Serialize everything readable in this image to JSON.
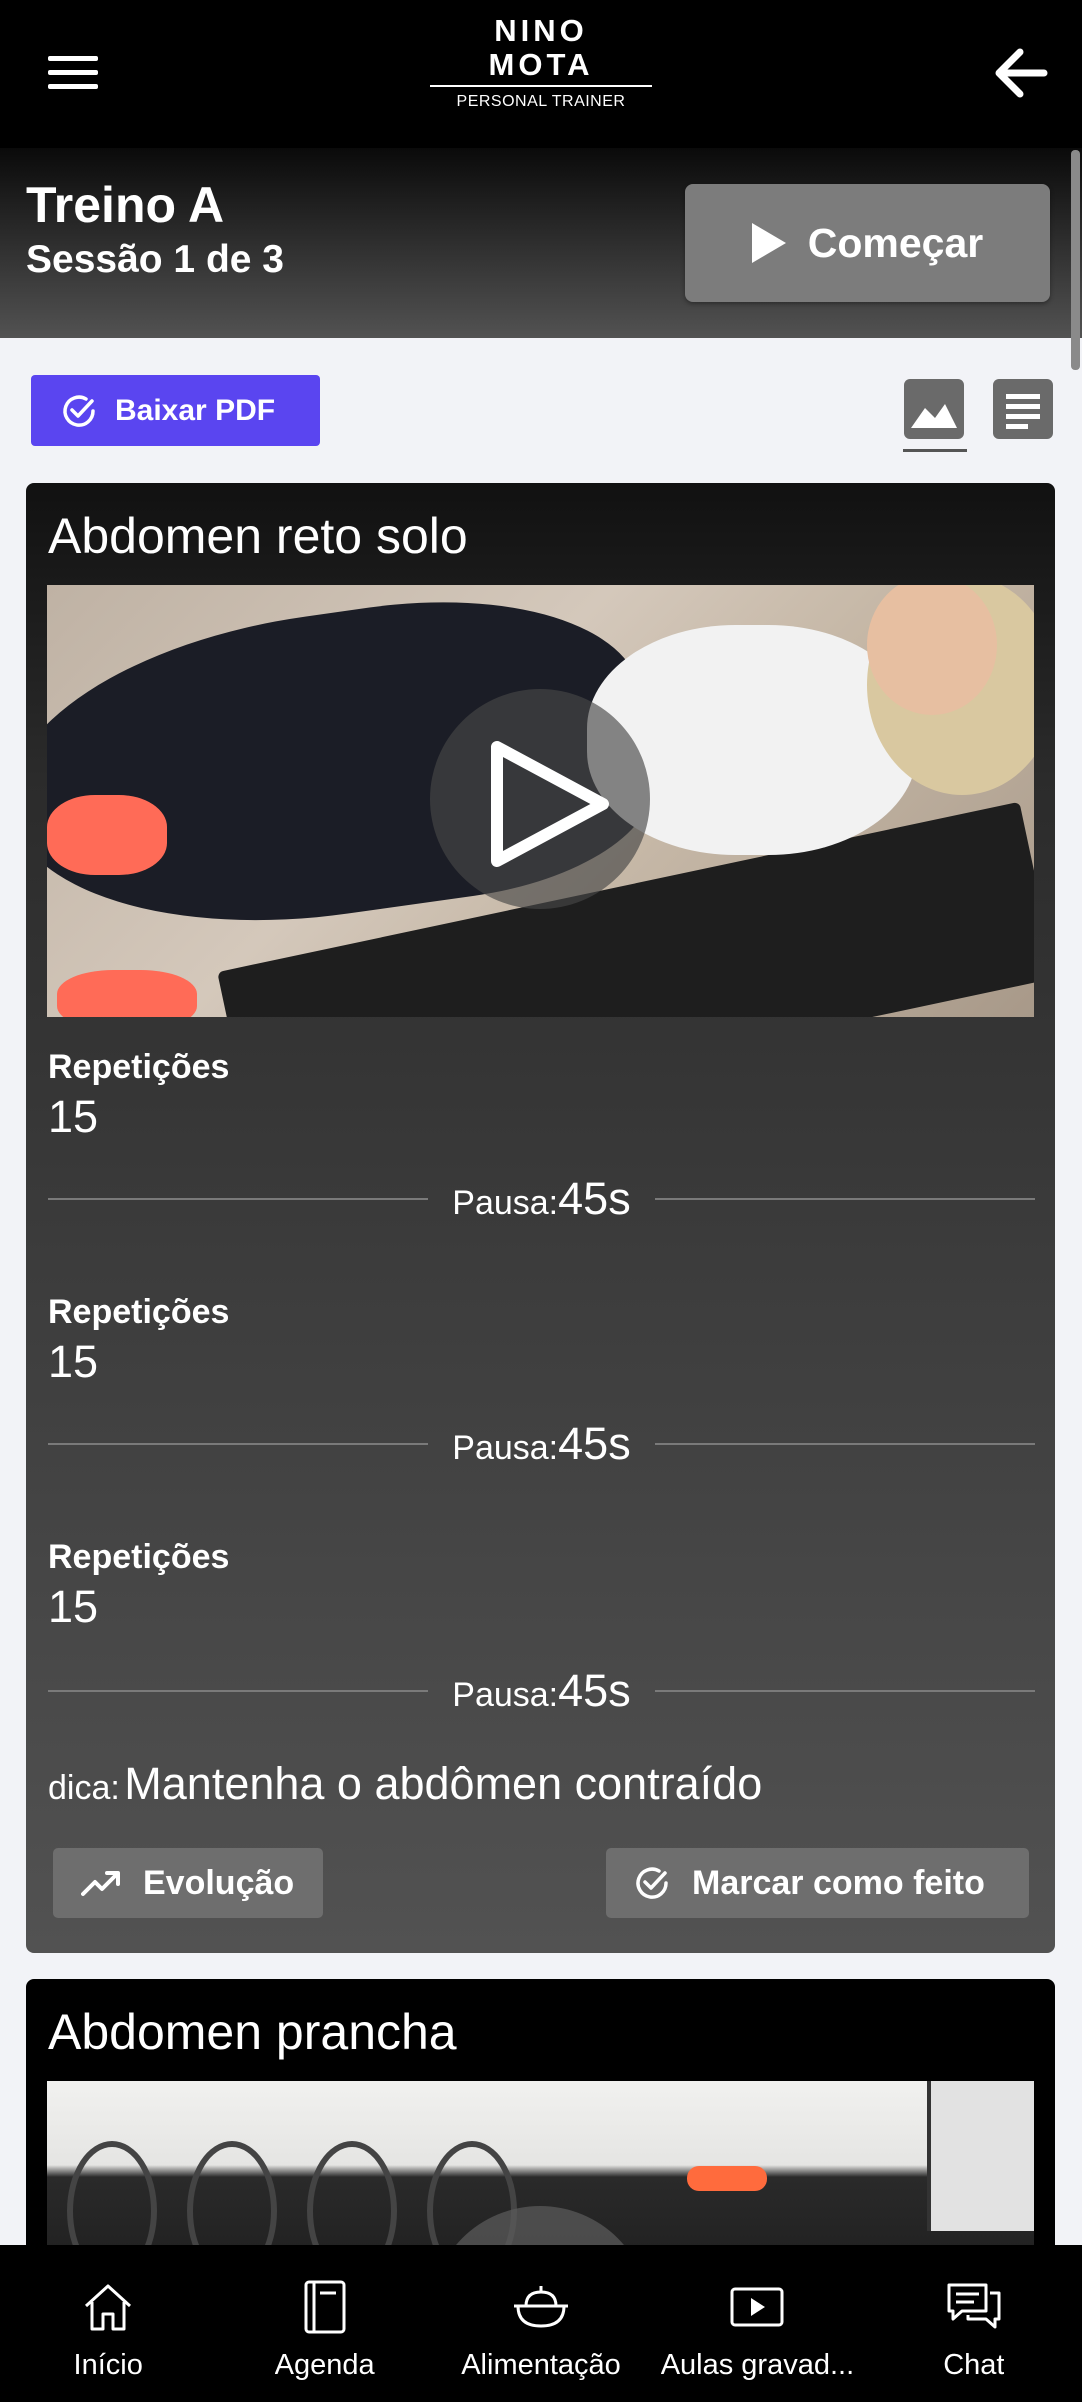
{
  "brand": {
    "line1": "NINO",
    "line2": "MOTA",
    "tagline": "PERSONAL TRAINER"
  },
  "session": {
    "title": "Treino A",
    "subtitle": "Sessão 1 de 3",
    "start_label": "Começar"
  },
  "toolbar": {
    "pdf_label": "Baixar PDF",
    "active_view": "image"
  },
  "exercises": [
    {
      "name": "Abdomen reto solo",
      "sets": [
        {
          "reps_label": "Repetições",
          "reps": "15",
          "pause_label": "Pausa:",
          "pause": "45s"
        },
        {
          "reps_label": "Repetições",
          "reps": "15",
          "pause_label": "Pausa:",
          "pause": "45s"
        },
        {
          "reps_label": "Repetições",
          "reps": "15",
          "pause_label": "Pausa:",
          "pause": "45s"
        }
      ],
      "tip_label": "dica:",
      "tip": "Mantenha o abdômen contraído",
      "evolution_label": "Evolução",
      "done_label": "Marcar como feito"
    },
    {
      "name": "Abdomen prancha"
    }
  ],
  "bottom_nav": [
    {
      "label": "Início",
      "icon": "home-icon"
    },
    {
      "label": "Agenda",
      "icon": "notebook-icon"
    },
    {
      "label": "Alimentação",
      "icon": "food-bowl-icon"
    },
    {
      "label": "Aulas gravad...",
      "icon": "video-play-icon"
    },
    {
      "label": "Chat",
      "icon": "chat-icon"
    }
  ],
  "colors": {
    "accent": "#5a45f0",
    "topbar": "#000000",
    "button_gray": "#7c7c7c"
  }
}
